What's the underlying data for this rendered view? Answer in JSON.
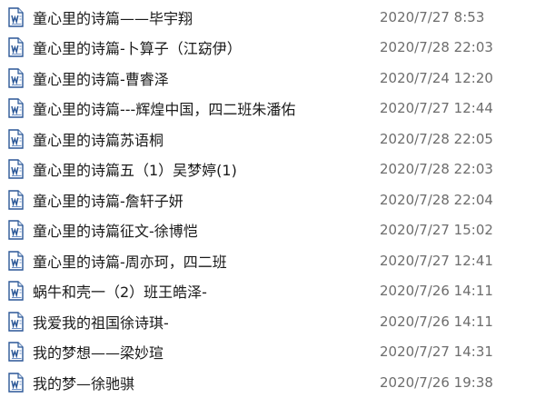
{
  "icons": {
    "file_icon": "word-document-icon",
    "icon_color": "#2b5797"
  },
  "files": [
    {
      "name": "童心里的诗篇——毕宇翔",
      "date": "2020/7/27 8:53"
    },
    {
      "name": "童心里的诗篇-卜算子（江窈伊）",
      "date": "2020/7/28 22:03"
    },
    {
      "name": "童心里的诗篇-曹睿泽",
      "date": "2020/7/24 12:20"
    },
    {
      "name": "童心里的诗篇---辉煌中国，四二班朱潘佑",
      "date": "2020/7/27 12:44"
    },
    {
      "name": "童心里的诗篇苏语桐",
      "date": "2020/7/28 22:05"
    },
    {
      "name": "童心里的诗篇五（1）吴梦婷(1)",
      "date": "2020/7/28 22:03"
    },
    {
      "name": "童心里的诗篇-詹轩子妍",
      "date": "2020/7/28 22:04"
    },
    {
      "name": "童心里的诗篇征文-徐博恺",
      "date": "2020/7/27 15:02"
    },
    {
      "name": "童心里的诗篇-周亦珂，四二班",
      "date": "2020/7/27 12:41"
    },
    {
      "name": "蜗牛和壳一（2）班王皓泽-",
      "date": "2020/7/26 14:11"
    },
    {
      "name": "我爱我的祖国徐诗琪-",
      "date": "2020/7/26 14:11"
    },
    {
      "name": "我的梦想——梁妙瑄",
      "date": "2020/7/27 14:31"
    },
    {
      "name": "我的梦—徐驰骐",
      "date": "2020/7/26 19:38"
    }
  ]
}
